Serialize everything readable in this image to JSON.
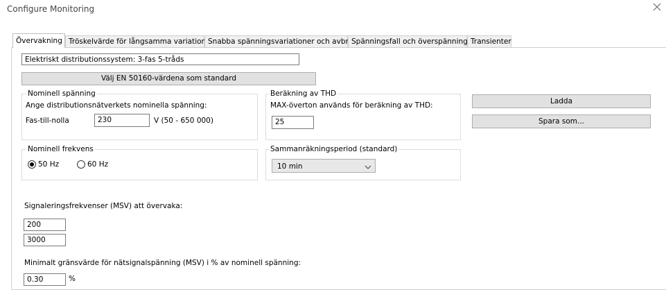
{
  "window": {
    "title": "Configure Monitoring"
  },
  "tabs": [
    {
      "label": "Övervakning"
    },
    {
      "label": "Tröskelvärde för långsamma variationer"
    },
    {
      "label": "Snabba spänningsvariationer och avbrott"
    },
    {
      "label": "Spänningsfall och överspänningar"
    },
    {
      "label": "Transienter"
    }
  ],
  "system": {
    "distribution_value": "Elektriskt distributionssystem: 3-fas 5-tråds",
    "en50160_button": "Välj EN 50160-värdena som standard"
  },
  "nominal_voltage": {
    "legend": "Nominell spänning",
    "description": "Ange distributionsnätverkets nominella spänning:",
    "field_label": "Fas-till-nolla",
    "value": "230",
    "unit_range": "V (50 - 650 000)"
  },
  "thd": {
    "legend": "Beräkning av THD",
    "description": "MAX-överton används för beräkning av THD:",
    "value": "25"
  },
  "buttons": {
    "load": "Ladda",
    "save_as": "Spara som..."
  },
  "nominal_frequency": {
    "legend": "Nominell frekvens",
    "options": [
      {
        "label": "50 Hz",
        "selected": true
      },
      {
        "label": "60 Hz",
        "selected": false
      }
    ]
  },
  "aggregation": {
    "legend": "Sammanräkningsperiod (standard)",
    "selected": "10 min"
  },
  "msv": {
    "label": "Signaleringsfrekvenser (MSV) att övervaka:",
    "values": [
      "200",
      "3000"
    ],
    "min_label": "Minimalt gränsvärde för nätsignalspänning (MSV) i % av nominell spänning:",
    "min_value": "0.30",
    "min_unit": "%"
  }
}
